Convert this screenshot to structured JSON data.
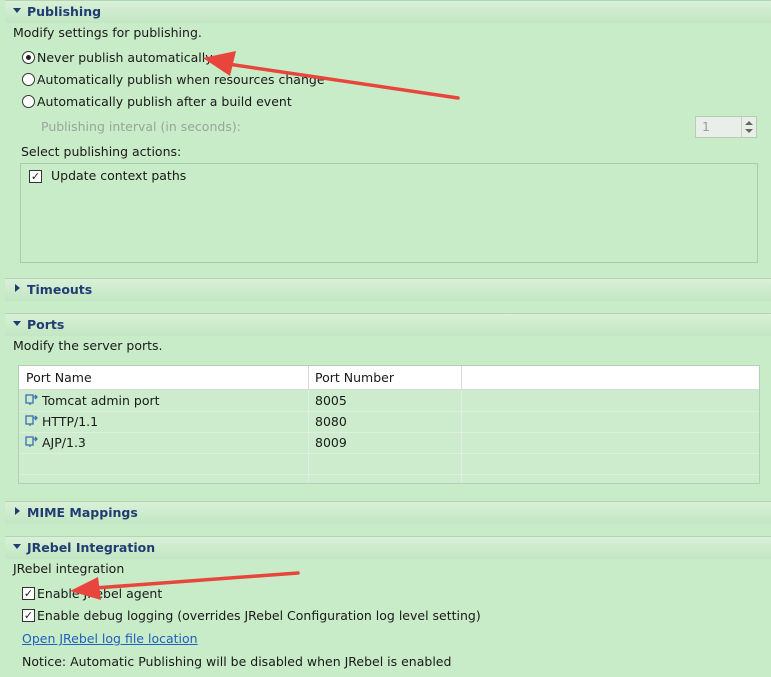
{
  "publishing": {
    "title": "Publishing",
    "description": "Modify settings for publishing.",
    "options": [
      {
        "label": "Never publish automatically",
        "selected": true
      },
      {
        "label": "Automatically publish when resources change",
        "selected": false
      },
      {
        "label": "Automatically publish after a build event",
        "selected": false
      }
    ],
    "interval_label": "Publishing interval (in seconds):",
    "interval_value": "1",
    "actions_label": "Select publishing actions:",
    "actions": [
      {
        "label": "Update context paths",
        "checked": true
      }
    ]
  },
  "timeouts": {
    "title": "Timeouts"
  },
  "ports": {
    "title": "Ports",
    "description": "Modify the server ports.",
    "columns": [
      "Port Name",
      "Port Number"
    ],
    "rows": [
      {
        "name": "Tomcat admin port",
        "number": "8005"
      },
      {
        "name": "HTTP/1.1",
        "number": "8080"
      },
      {
        "name": "AJP/1.3",
        "number": "8009"
      }
    ]
  },
  "mime": {
    "title": "MIME Mappings"
  },
  "jrebel": {
    "title": "JRebel Integration",
    "description": "JRebel integration",
    "options": [
      {
        "label": "Enable JRebel agent",
        "checked": true
      },
      {
        "label": "Enable debug logging (overrides JRebel Configuration log level setting)",
        "checked": true
      }
    ],
    "link": "Open JRebel log file location",
    "notice": "Notice: Automatic Publishing will be disabled when JRebel is enabled"
  },
  "colors": {
    "background": "#c8ebc8",
    "section_title": "#203d72",
    "link": "#2060c0",
    "annotation_arrow": "#e8453c"
  },
  "icons": {
    "expanded": "triangle-down-icon",
    "collapsed": "triangle-right-icon",
    "port": "port-connector-icon"
  }
}
